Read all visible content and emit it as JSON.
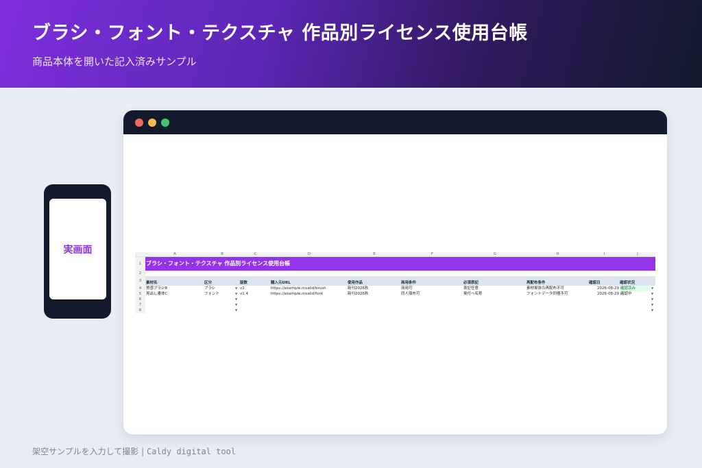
{
  "hero": {
    "title": "ブラシ・フォント・テクスチャ 作品別ライセンス使用台帳",
    "subtitle": "商品本体を開いた記入済みサンプル"
  },
  "phone": {
    "label": "実画面"
  },
  "sheet": {
    "col_letters": [
      "A",
      "B",
      "C",
      "D",
      "E",
      "F",
      "G",
      "H",
      "I",
      "J"
    ],
    "row_numbers": [
      "1",
      "2",
      "3",
      "4",
      "5",
      "6",
      "7",
      "8"
    ],
    "title": "ブラシ・フォント・テクスチャ 作品別ライセンス使用台帳",
    "headers": [
      "素材名",
      "区分",
      "版数",
      "購入元URL",
      "使用作品",
      "商用条件",
      "必須表記",
      "再配布条件",
      "確認日",
      "確認状況"
    ],
    "rows": [
      [
        "質感ブラシB",
        "ブラシ",
        "v2",
        "https://example.invalid/brush",
        "新刊2026秋",
        "商用可",
        "表記任意",
        "素材単体の再配布不可",
        "2026-08-29",
        "確認済み"
      ],
      [
        "見出し書体C",
        "フォント",
        "v1.4",
        "https://example.invalid/font",
        "新刊2026秋",
        "同人頒布可",
        "奥付へ名称",
        "フォントデータ同梱不可",
        "2026-08-29",
        "確認中"
      ]
    ],
    "dropdown_glyph": "▼",
    "status_colors": {
      "done": "#dcfce7",
      "accent": "#9333ea"
    }
  },
  "footer": {
    "caption": "架空サンプルを入力して撮影",
    "separator": "|",
    "brand": "Caldy digital tool"
  }
}
